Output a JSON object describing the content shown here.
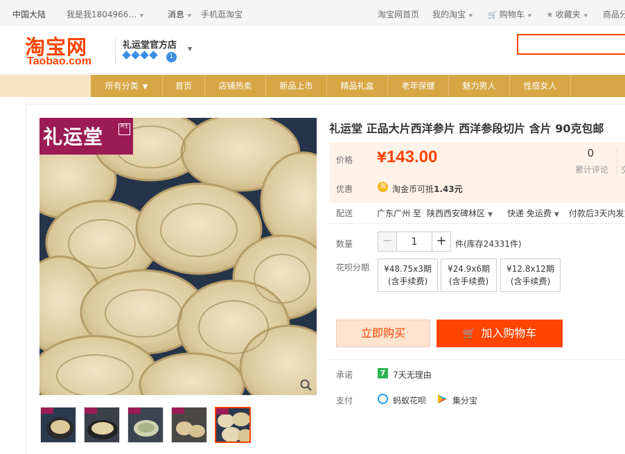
{
  "topbar": {
    "region": "中国大陆",
    "user": "我是我1804966...",
    "messages": "消息",
    "mobile": "手机逛淘宝",
    "home": "淘宝网首页",
    "my_taobao": "我的淘宝",
    "cart": "购物车",
    "favorites": "收藏夹",
    "products": "商品分"
  },
  "header": {
    "logo_cn": "淘宝网",
    "logo_en": "Taobao.com",
    "shop_name": "礼运堂官方店",
    "shop_badge": "1",
    "search_placeholder": ""
  },
  "nav": {
    "items": [
      "所有分类",
      "首页",
      "店铺热卖",
      "新品上市",
      "精品礼盒",
      "老年保健",
      "魅力男人",
      "性感女人"
    ]
  },
  "gallery": {
    "brand_text": "礼运堂",
    "seal_text": "养生",
    "thumbnail_count": 5,
    "active_thumbnail": 5
  },
  "product": {
    "title": "礼运堂 正品大片西洋参片 西洋参段切片 含片 90克包邮",
    "price_label": "价格",
    "currency": "¥",
    "price": "143.00",
    "reviews_count": "0",
    "reviews_label": "累计评论",
    "reviews_cut": "交",
    "promo_label": "优惠",
    "coin_icon_text": "淘",
    "promo_text": "淘金币可抵",
    "promo_value": "1.43元",
    "ship_label": "配送",
    "ship_from": "广东广州 至",
    "ship_to": "陕西西安碑林区",
    "ship_method": "快递 免运费",
    "ship_time": "付款后3天内发货",
    "qty_label": "数量",
    "qty_value": "1",
    "qty_minus": "−",
    "qty_plus": "+",
    "stock_text": "件(库存24331件)",
    "installment_label": "花呗分期",
    "installments": [
      {
        "price": "¥48.75x3期",
        "fee": "(含手续费)"
      },
      {
        "price": "¥24.9x6期",
        "fee": "(含手续费)"
      },
      {
        "price": "¥12.8x12期",
        "fee": "(含手续费)"
      }
    ],
    "buy_now": "立即购买",
    "add_to_cart": "加入购物车",
    "promise_label": "承诺",
    "promise_icon": "7",
    "promise_text": "7天无理由",
    "pay_label": "支付",
    "pay_option_1": "蚂蚁花呗",
    "pay_option_2": "集分宝"
  },
  "colors": {
    "accent": "#ff4400",
    "nav_gold": "#d7a645",
    "price_bg": "#fff2e8",
    "brand_magenta": "#9b1b55"
  }
}
